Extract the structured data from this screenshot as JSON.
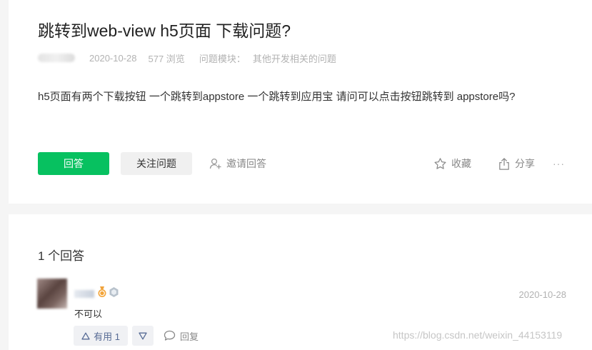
{
  "question": {
    "title": "跳转到web-view h5页面 下载问题?",
    "date": "2020-10-28",
    "views": "577 浏览",
    "module_label": "问题模块：",
    "module_value": "其他开发相关的问题",
    "body": "h5页面有两个下载按钮 一个跳转到appstore 一个跳转到应用宝 请问可以点击按钮跳转到 appstore吗?"
  },
  "actions": {
    "answer": "回答",
    "follow": "关注问题",
    "invite": "邀请回答",
    "collect": "收藏",
    "share": "分享",
    "more": "···"
  },
  "answers": {
    "count_label": "1 个回答",
    "items": [
      {
        "date": "2020-10-28",
        "text": "不可以",
        "upvote_label": "有用 1",
        "reply_label": "回复"
      }
    ]
  },
  "watermark": "https://blog.csdn.net/weixin_44153119",
  "colors": {
    "accent_green": "#07c160",
    "link_blue": "#576b95",
    "muted": "#b2b2b2"
  }
}
